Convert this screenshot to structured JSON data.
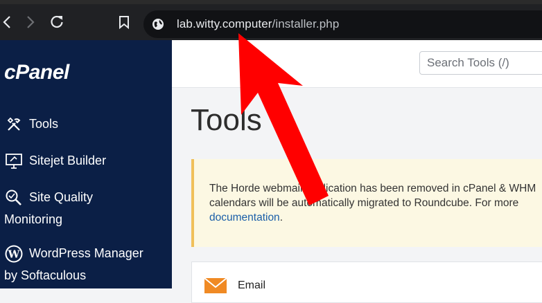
{
  "browser": {
    "url_host": "lab.witty.computer",
    "url_path": "/installer.php"
  },
  "sidebar": {
    "logo": "cPanel",
    "items": [
      {
        "label": "Tools",
        "icon": "tools-icon"
      },
      {
        "label": "Sitejet Builder",
        "icon": "sitejet-icon"
      },
      {
        "label": "Site Quality",
        "label2": "Monitoring",
        "icon": "site-quality-icon"
      },
      {
        "label": "WordPress Manager",
        "label2": "by Softaculous",
        "icon": "wordpress-icon"
      }
    ]
  },
  "main": {
    "search_placeholder": "Search Tools (/)",
    "title": "Tools",
    "notice": {
      "line1": "The Horde webmail application has been removed in cPanel & WHM",
      "line2": "calendars will be automatically migrated to Roundcube. For more",
      "link": "documentation",
      "after_link": "."
    },
    "email_panel_title": "Email"
  },
  "colors": {
    "sidebar_bg": "#0b1f46",
    "browser_bg": "#202124",
    "arrow": "#ff0000",
    "notice_bg": "#fcf8e3",
    "notice_border": "#f0c05a",
    "link": "#1a5ea8"
  }
}
